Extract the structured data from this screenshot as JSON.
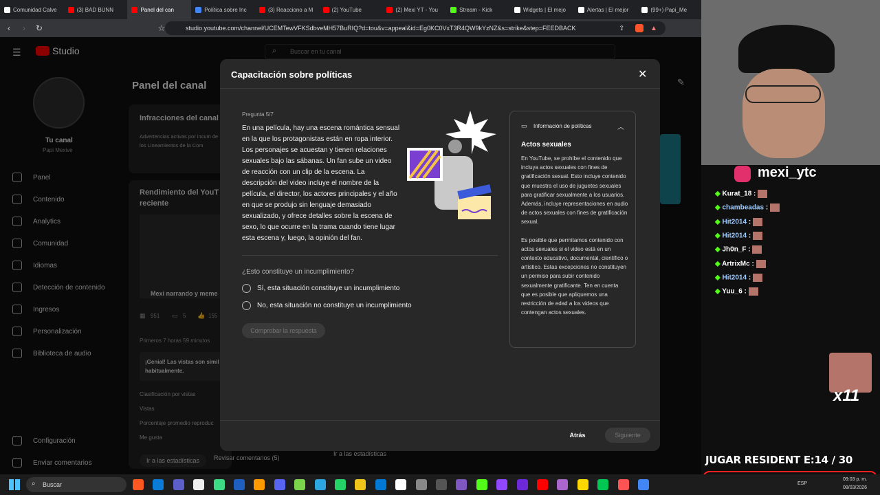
{
  "browser": {
    "tabs": [
      {
        "label": "Comunidad Calve",
        "color": "#ffffff"
      },
      {
        "label": "(3) BAD BUNN",
        "color": "#ff0000"
      },
      {
        "label": "Panel del can",
        "color": "#ff0000",
        "active": true
      },
      {
        "label": "Política sobre Inc",
        "color": "#4285f4"
      },
      {
        "label": "(3) Reacciono a M",
        "color": "#ff0000"
      },
      {
        "label": "(2) YouTube",
        "color": "#ff0000"
      },
      {
        "label": "(2) Mexi YT - You",
        "color": "#ff0000"
      },
      {
        "label": "Stream - Kick",
        "color": "#53fc18"
      },
      {
        "label": "Widgets | El mejo",
        "color": "#ffffff"
      },
      {
        "label": "Alertas | El mejor",
        "color": "#ffffff"
      },
      {
        "label": "(99+) Papi_Me",
        "color": "#ffffff"
      }
    ],
    "url": "studio.youtube.com/channel/UCEMTewVFKSdbveMH57BuRIQ?d=tou&v=appeal&id=Eg0KC0VxT3R4QW9kYzNZ&s=strike&step=FEEDBACK"
  },
  "studio": {
    "logo": "Studio",
    "search_placeholder": "Buscar en tu canal",
    "channel_label": "Tu canal",
    "channel_name": "Papi Mexive",
    "nav": [
      "Panel",
      "Contenido",
      "Analytics",
      "Comunidad",
      "Idiomas",
      "Detección de contenido",
      "Ingresos",
      "Personalización",
      "Biblioteca de audio"
    ],
    "nav_bottom": [
      "Configuración",
      "Enviar comentarios"
    ],
    "page_title": "Panel del canal",
    "infractions_title": "Infracciones del canal",
    "infractions_text": "Advertencias activas por incum de los Lineamientos de la Com",
    "performance_title": "Rendimiento del YouT reciente",
    "video_title": "Mexi narrando y meme",
    "stats": [
      "951",
      "5",
      "155"
    ],
    "first_hours": "Primeros 7 horas 59 minutos",
    "great_text": "¡Genial! Las vistas son simil habitualmente.",
    "metrics": [
      "Clasificación por vistas",
      "Vistas",
      "Porcentaje promedio reproduc",
      "Me gusta"
    ],
    "link_stats": "Ir a las estadísticas",
    "link_comments": "Revisar comentarios (5)",
    "link_stats_right": "Ir a las estadísticas"
  },
  "modal": {
    "title": "Capacitación sobre políticas",
    "question_num": "Pregunta 5/7",
    "question": "En una película, hay una escena romántica sensual en la que los protagonistas están en ropa interior. Los personajes se acuestan y tienen relaciones sexuales bajo las sábanas. Un fan sube un video de reacción con un clip de la escena. La descripción del video incluye el nombre de la película, el director, los actores principales y el año en que se produjo sin lenguaje demasiado sexualizado, y ofrece detalles sobre la escena de sexo, lo que ocurre en la trama cuando tiene lugar esta escena y, luego, la opinión del fan.",
    "ask": "¿Esto constituye un incumplimiento?",
    "option_yes": "Sí, esta situación constituye un incumplimiento",
    "option_no": "No, esta situación no constituye un incumplimiento",
    "check_button": "Comprobar la respuesta",
    "policy_header": "Información de políticas",
    "policy_title": "Actos sexuales",
    "policy_text_1": "En YouTube, se prohíbe el contenido que incluya actos sexuales con fines de gratificación sexual. Esto incluye contenido que muestra el uso de juguetes sexuales para gratificar sexualmente a los usuarios. Además, incluye representaciones en audio de actos sexuales con fines de gratificación sexual.",
    "policy_text_2": "Es posible que permitamos contenido con actos sexuales si el video está en un contexto educativo, documental, científico o artístico. Estas excepciones no constituyen un permiso para subir contenido sexualmente gratificante. Ten en cuenta que es posible que apliquemos una restricción de edad a los videos que contengan actos sexuales.",
    "back_button": "Atrás",
    "next_button": "Siguiente"
  },
  "stream": {
    "instagram": "mexi_ytc",
    "chat": [
      {
        "user": "Kurat_18",
        "color": "#ffffff"
      },
      {
        "user": "chambeadas",
        "color": "#9ecbff"
      },
      {
        "user": "Hit2014",
        "color": "#9ecbff"
      },
      {
        "user": "Hit2014",
        "color": "#9ecbff"
      },
      {
        "user": "Jh0n_F",
        "color": "#ffffff"
      },
      {
        "user": "ArtrixMc",
        "color": "#ffffff"
      },
      {
        "user": "Hit2014",
        "color": "#9ecbff"
      },
      {
        "user": "Yuu_6",
        "color": "#ffffff"
      }
    ],
    "multiplier": "x11",
    "game_status": "JUGAR RESIDENT E:14  / 30",
    "progress": 0.47
  },
  "taskbar": {
    "search": "Buscar",
    "lang": "ESP",
    "time": "09:03 p. m.",
    "date": "08/03/2026"
  }
}
